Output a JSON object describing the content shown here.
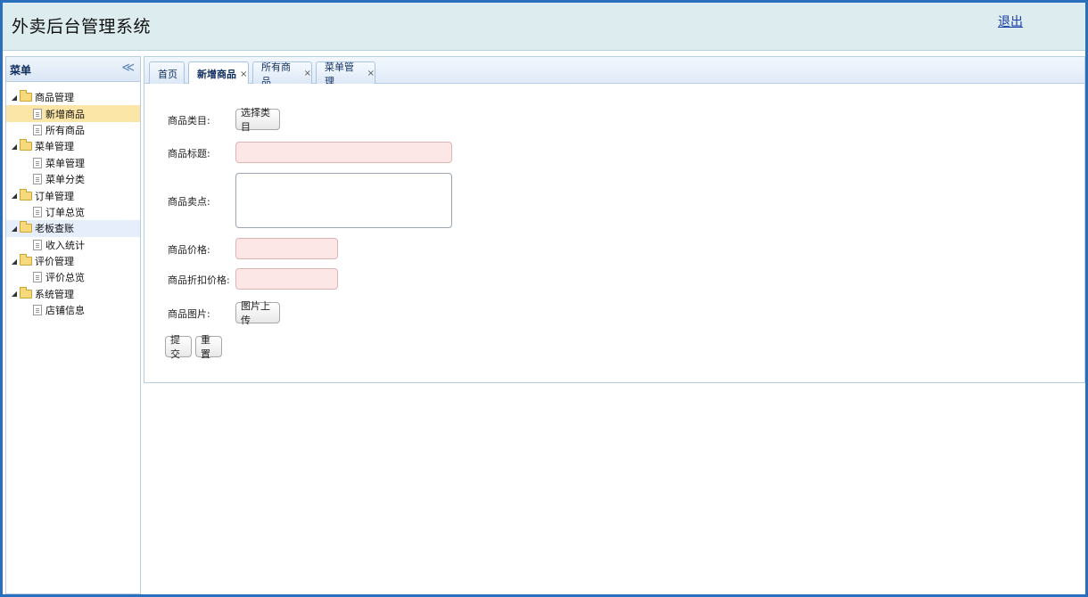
{
  "header": {
    "title": "外卖后台管理系统",
    "logout_label": "退出"
  },
  "sidebar": {
    "title": "菜单",
    "collapse_glyph": "≪",
    "groups": [
      {
        "label": "商品管理",
        "items": [
          {
            "label": "新增商品"
          },
          {
            "label": "所有商品"
          }
        ]
      },
      {
        "label": "菜单管理",
        "items": [
          {
            "label": "菜单管理"
          },
          {
            "label": "菜单分类"
          }
        ]
      },
      {
        "label": "订单管理",
        "items": [
          {
            "label": "订单总览"
          }
        ]
      },
      {
        "label": "老板查账",
        "items": [
          {
            "label": "收入统计"
          }
        ]
      },
      {
        "label": "评价管理",
        "items": [
          {
            "label": "评价总览"
          }
        ]
      },
      {
        "label": "系统管理",
        "items": [
          {
            "label": "店铺信息"
          }
        ]
      }
    ]
  },
  "tabs": [
    {
      "label": "首页",
      "close": ""
    },
    {
      "label": "新增商品",
      "close": "×"
    },
    {
      "label": "所有商品",
      "close": "×"
    },
    {
      "label": "菜单管理",
      "close": "×"
    }
  ],
  "form": {
    "category_label": "商品类目:",
    "category_button": "选择类目",
    "title_label": "商品标题:",
    "title_value": "",
    "selling_point_label": "商品卖点:",
    "selling_point_value": "",
    "price_label": "商品价格:",
    "price_value": "",
    "discount_price_label": "商品折扣价格:",
    "discount_price_value": "",
    "image_label": "商品图片:",
    "upload_button": "图片上传",
    "submit_button": "提交",
    "reset_button": "重置"
  },
  "colors": {
    "frame_border": "#2a6fbe",
    "header_bg": "#dcecef",
    "selected_item_bg": "#fbe6a7",
    "required_field_bg": "#fce6e6"
  }
}
